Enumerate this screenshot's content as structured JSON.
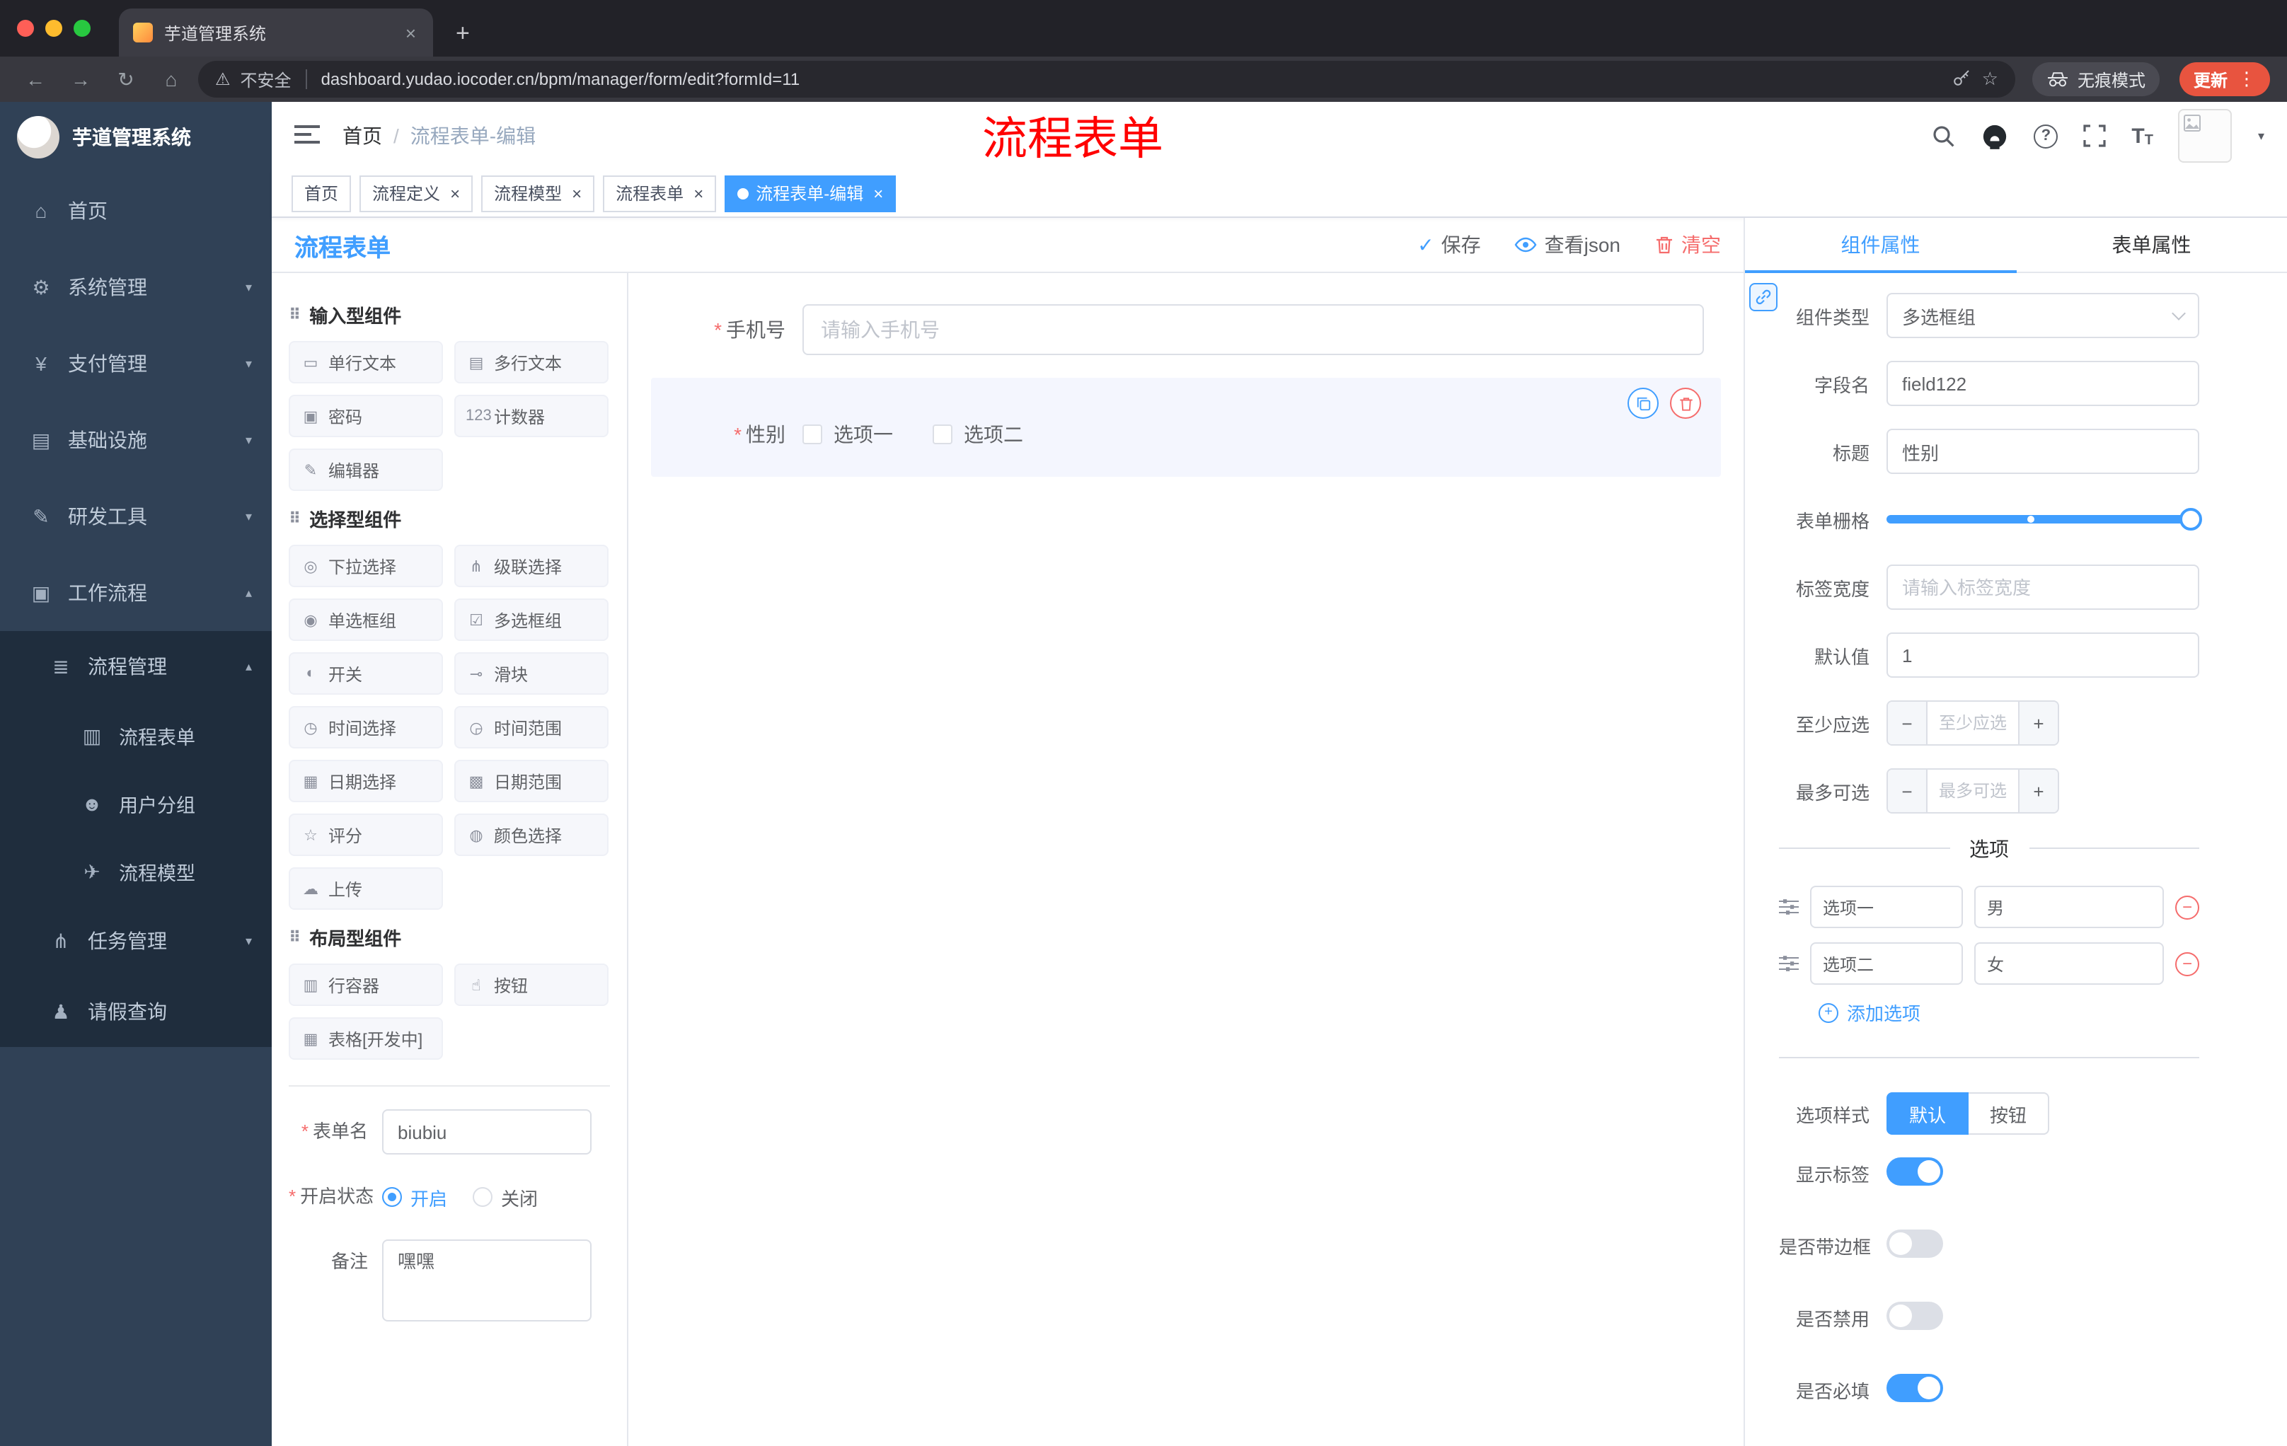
{
  "colors": {
    "primary": "#409EFF",
    "danger": "#F56C6C"
  },
  "glyphs": {
    "close": "×",
    "plus": "+",
    "minus": "−",
    "dots": "⋮",
    "back": "←",
    "forward": "→",
    "reload": "↻",
    "home": "⌂",
    "warning": "⚠",
    "star": "☆",
    "check": "✓",
    "caret_down": "▾",
    "question": "?",
    "text_icon": "T"
  },
  "browser": {
    "tab_title": "芋道管理系统",
    "security_label": "不安全",
    "url": "dashboard.yudao.iocoder.cn/bpm/manager/form/edit?formId=11",
    "incognito_label": "无痕模式",
    "update_label": "更新"
  },
  "app_header": {
    "logo_title": "芋道管理系统",
    "breadcrumb_root": "首页",
    "breadcrumb_current": "流程表单-编辑",
    "annotation": "流程表单"
  },
  "sidebar": {
    "items": [
      {
        "icon": "⌂",
        "label": "首页",
        "cls": "menu-item"
      },
      {
        "icon": "⚙",
        "label": "系统管理",
        "arrow": "▾",
        "cls": "menu-item"
      },
      {
        "icon": "¥",
        "label": "支付管理",
        "arrow": "▾",
        "cls": "menu-item"
      },
      {
        "icon": "▤",
        "label": "基础设施",
        "arrow": "▾",
        "cls": "menu-item"
      },
      {
        "icon": "✎",
        "label": "研发工具",
        "arrow": "▾",
        "cls": "menu-item"
      },
      {
        "icon": "▣",
        "label": "工作流程",
        "arrow": "▴",
        "cls": "menu-item"
      },
      {
        "icon": "≣",
        "label": "流程管理",
        "arrow": "▴",
        "cls": "menu-item sub"
      },
      {
        "icon": "▥",
        "label": "流程表单",
        "cls": "menu-item subsub"
      },
      {
        "icon": "☻",
        "label": "用户分组",
        "cls": "menu-item subsub"
      },
      {
        "icon": "✈",
        "label": "流程模型",
        "cls": "menu-item subsub"
      },
      {
        "icon": "⋔",
        "label": "任务管理",
        "arrow": "▾",
        "cls": "menu-item sub"
      },
      {
        "icon": "♟",
        "label": "请假查询",
        "cls": "menu-item sub"
      }
    ]
  },
  "tags": {
    "items": [
      {
        "label": "首页"
      },
      {
        "label": "流程定义",
        "closable": true
      },
      {
        "label": "流程模型",
        "closable": true
      },
      {
        "label": "流程表单",
        "closable": true
      },
      {
        "label": "流程表单-编辑",
        "closable": true,
        "active": true
      }
    ]
  },
  "designer": {
    "title": "流程表单",
    "save_label": "保存",
    "view_json_label": "查看json",
    "clear_label": "清空"
  },
  "palette": {
    "group_icon": "⠿",
    "groups": [
      {
        "title": "输入型组件",
        "items": [
          {
            "icon": "▭",
            "label": "单行文本"
          },
          {
            "icon": "▤",
            "label": "多行文本"
          },
          {
            "icon": "▣",
            "label": "密码"
          },
          {
            "icon": "123",
            "label": "计数器"
          },
          {
            "icon": "✎",
            "label": "编辑器"
          }
        ]
      },
      {
        "title": "选择型组件",
        "items": [
          {
            "icon": "◎",
            "label": "下拉选择"
          },
          {
            "icon": "⋔",
            "label": "级联选择"
          },
          {
            "icon": "◉",
            "label": "单选框组"
          },
          {
            "icon": "☑",
            "label": "多选框组"
          },
          {
            "icon": "◐",
            "label": "开关"
          },
          {
            "icon": "⊸",
            "label": "滑块"
          },
          {
            "icon": "◷",
            "label": "时间选择"
          },
          {
            "icon": "◶",
            "label": "时间范围"
          },
          {
            "icon": "▦",
            "label": "日期选择"
          },
          {
            "icon": "▩",
            "label": "日期范围"
          },
          {
            "icon": "☆",
            "label": "评分"
          },
          {
            "icon": "◍",
            "label": "颜色选择"
          },
          {
            "icon": "☁",
            "label": "上传"
          }
        ]
      },
      {
        "title": "布局型组件",
        "items": [
          {
            "icon": "▥",
            "label": "行容器"
          },
          {
            "icon": "☝",
            "label": "按钮"
          },
          {
            "icon": "▦",
            "label": "表格[开发中]"
          }
        ]
      }
    ]
  },
  "meta_form": {
    "name_label": "表单名",
    "name_value": "biubiu",
    "status_label": "开启状态",
    "status_on": "开启",
    "status_off": "关闭",
    "status_selected": "开启",
    "remark_label": "备注",
    "remark_value": "嘿嘿"
  },
  "canvas": {
    "phone": {
      "label": "手机号",
      "placeholder": "请输入手机号"
    },
    "gender": {
      "label": "性别",
      "options": [
        "选项一",
        "选项二"
      ]
    }
  },
  "props": {
    "tab_component": "组件属性",
    "tab_form": "表单属性",
    "active_tab": "组件属性",
    "rows": {
      "type_label": "组件类型",
      "type_value": "多选框组",
      "field_label": "字段名",
      "field_value": "field122",
      "title_label": "标题",
      "title_value": "性别",
      "grid_label": "表单栅格",
      "width_label": "标签宽度",
      "width_placeholder": "请输入标签宽度",
      "default_label": "默认值",
      "default_value": "1",
      "min_label": "至少应选",
      "min_placeholder": "至少应选",
      "max_label": "最多可选",
      "max_placeholder": "最多可选"
    },
    "options_divider": "选项",
    "options": [
      {
        "label": "选项一",
        "value": "男"
      },
      {
        "label": "选项二",
        "value": "女"
      }
    ],
    "add_option": "添加选项",
    "style_label": "选项样式",
    "style_default": "默认",
    "style_button": "按钮",
    "style_active": "默认",
    "show_label": "显示标签",
    "border_label": "是否带边框",
    "disabled_label": "是否禁用",
    "required_label": "是否必填",
    "toggles": {
      "show_label": true,
      "border": false,
      "disabled": false,
      "required": true
    }
  }
}
